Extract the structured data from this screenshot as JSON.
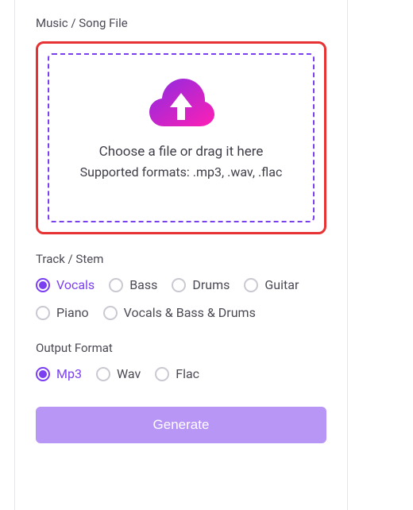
{
  "sections": {
    "upload_label": "Music / Song File",
    "dropzone": {
      "primary": "Choose a file or drag it here",
      "secondary": "Supported formats: .mp3, .wav, .flac"
    },
    "track_label": "Track / Stem",
    "track_options": [
      {
        "label": "Vocals",
        "selected": true
      },
      {
        "label": "Bass",
        "selected": false
      },
      {
        "label": "Drums",
        "selected": false
      },
      {
        "label": "Guitar",
        "selected": false
      },
      {
        "label": "Piano",
        "selected": false
      },
      {
        "label": "Vocals & Bass & Drums",
        "selected": false
      }
    ],
    "format_label": "Output Format",
    "format_options": [
      {
        "label": "Mp3",
        "selected": true
      },
      {
        "label": "Wav",
        "selected": false
      },
      {
        "label": "Flac",
        "selected": false
      }
    ],
    "generate_label": "Generate"
  },
  "colors": {
    "accent": "#7b3ff2",
    "highlight_border": "#e63232",
    "button_bg": "#b896f5"
  }
}
